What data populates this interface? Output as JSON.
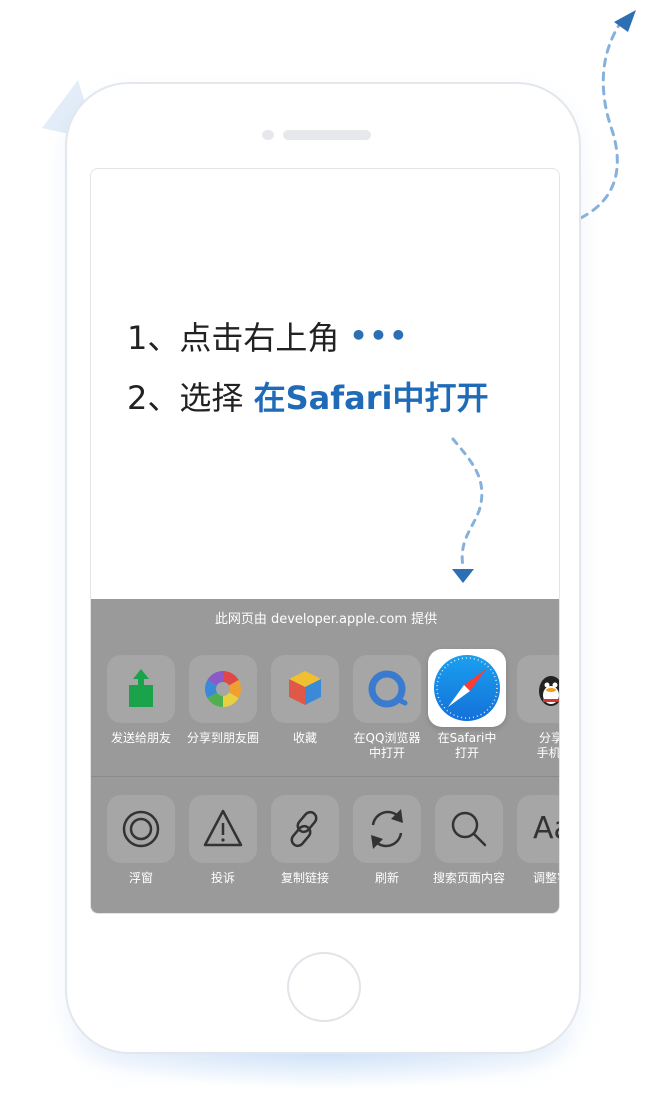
{
  "steps": [
    {
      "number": "1、",
      "text": "点击右上角",
      "dots": "•••"
    },
    {
      "number": "2、",
      "text": "选择",
      "highlight": "在Safari中打开"
    }
  ],
  "share_sheet": {
    "title": "此网页由 developer.apple.com 提供",
    "row1": [
      {
        "label": "发送给朋友",
        "icon": "share-upload-icon"
      },
      {
        "label": "分享到朋友圈",
        "icon": "moments-aperture-icon"
      },
      {
        "label": "收藏",
        "icon": "favorites-cube-icon"
      },
      {
        "label": "在QQ浏览器\n中打开",
        "icon": "qq-browser-icon"
      },
      {
        "label": "在Safari中\n打开",
        "icon": "safari-compass-icon"
      },
      {
        "label": "分享\n手机(",
        "icon": "qq-penguin-icon"
      }
    ],
    "row2": [
      {
        "label": "浮窗",
        "icon": "float-window-icon"
      },
      {
        "label": "投诉",
        "icon": "warning-triangle-icon"
      },
      {
        "label": "复制链接",
        "icon": "link-icon"
      },
      {
        "label": "刷新",
        "icon": "refresh-icon"
      },
      {
        "label": "搜索页面内容",
        "icon": "search-icon"
      },
      {
        "label": "调整字",
        "icon": "font-size-icon",
        "glyph": "Aa"
      }
    ]
  },
  "colors": {
    "accent": "#1f6bb8",
    "dotted_path": "#86b1dc",
    "sheet_bg": "#9a9a9a"
  }
}
